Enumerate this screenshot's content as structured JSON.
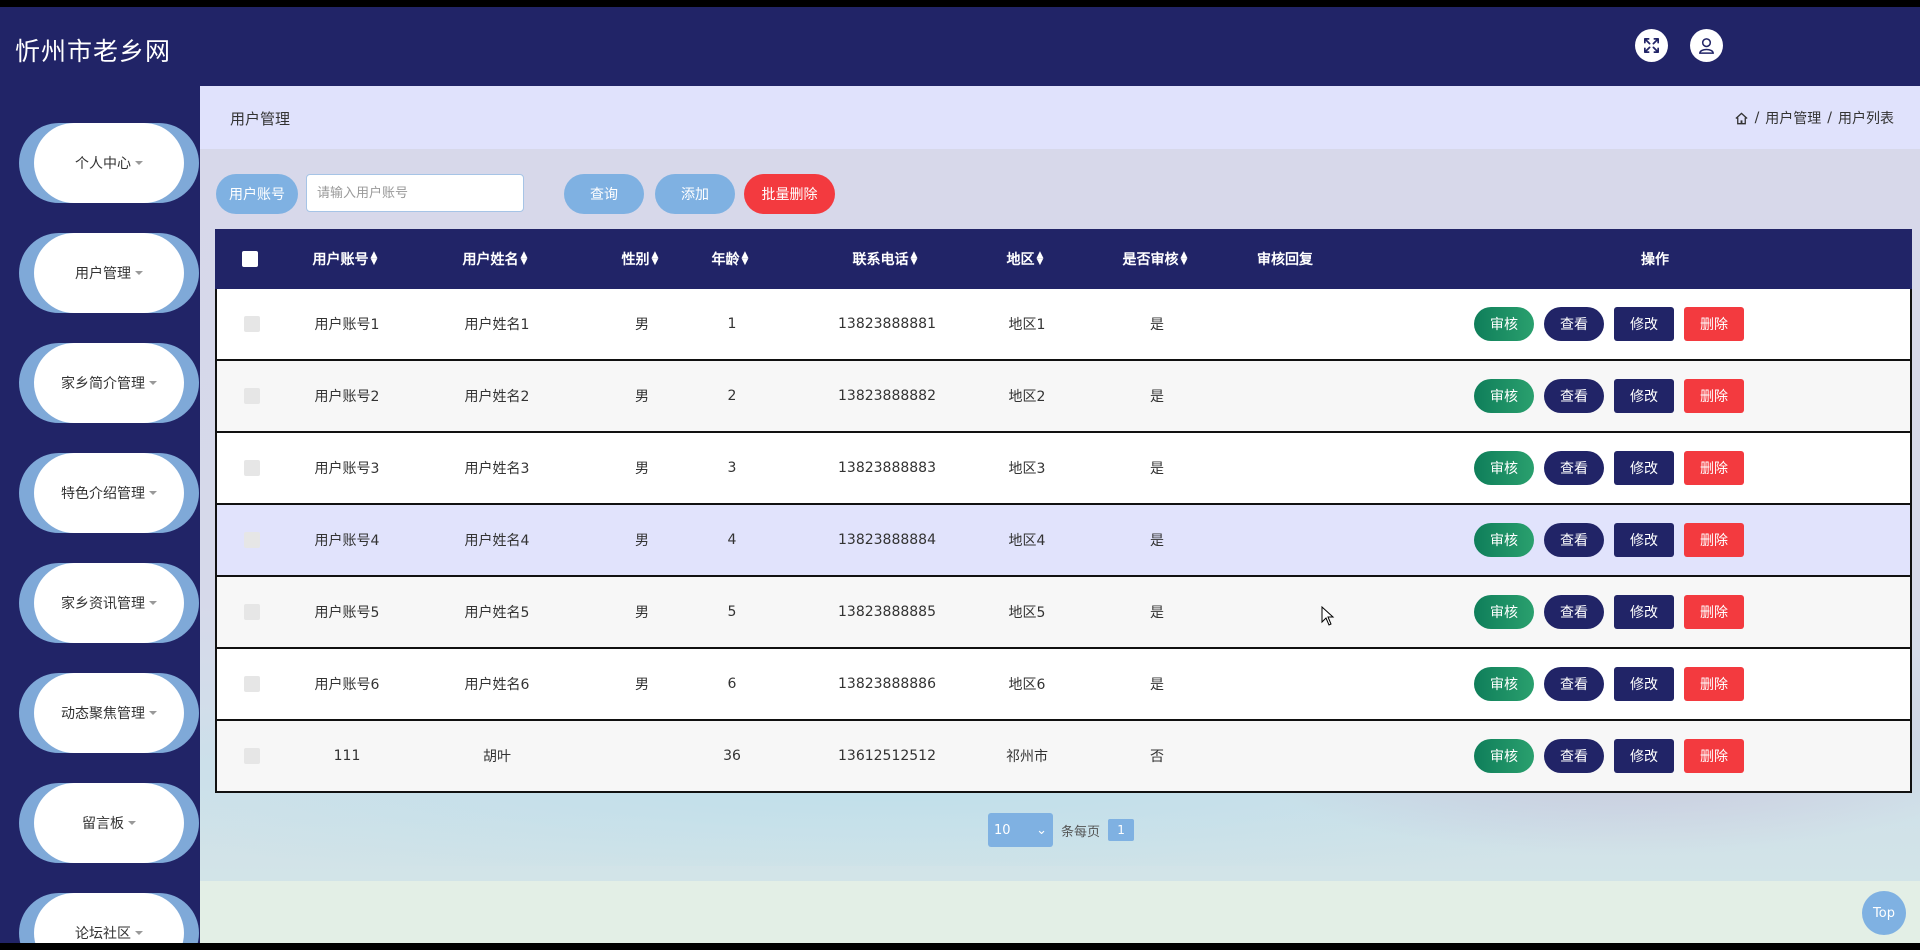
{
  "header": {
    "site_title": "忻州市老乡网"
  },
  "sidebar": {
    "items": [
      {
        "label": "个人中心"
      },
      {
        "label": "用户管理"
      },
      {
        "label": "家乡简介管理"
      },
      {
        "label": "特色介绍管理"
      },
      {
        "label": "家乡资讯管理"
      },
      {
        "label": "动态聚焦管理"
      },
      {
        "label": "留言板"
      },
      {
        "label": "论坛社区"
      }
    ]
  },
  "breadcrumb": {
    "page_title": "用户管理",
    "items": [
      "用户管理",
      "用户列表"
    ],
    "separator": "/"
  },
  "search": {
    "label": "用户账号",
    "placeholder": "请输入用户账号",
    "query_label": "查询",
    "add_label": "添加",
    "batch_delete_label": "批量删除"
  },
  "table": {
    "columns": {
      "account": "用户账号",
      "name": "用户姓名",
      "gender": "性别",
      "age": "年龄",
      "phone": "联系电话",
      "region": "地区",
      "reviewed": "是否审核",
      "reply": "审核回复",
      "ops": "操作"
    },
    "rows": [
      {
        "account": "用户账号1",
        "name": "用户姓名1",
        "gender": "男",
        "age": "1",
        "phone": "13823888881",
        "region": "地区1",
        "reviewed": "是",
        "reply": ""
      },
      {
        "account": "用户账号2",
        "name": "用户姓名2",
        "gender": "男",
        "age": "2",
        "phone": "13823888882",
        "region": "地区2",
        "reviewed": "是",
        "reply": ""
      },
      {
        "account": "用户账号3",
        "name": "用户姓名3",
        "gender": "男",
        "age": "3",
        "phone": "13823888883",
        "region": "地区3",
        "reviewed": "是",
        "reply": ""
      },
      {
        "account": "用户账号4",
        "name": "用户姓名4",
        "gender": "男",
        "age": "4",
        "phone": "13823888884",
        "region": "地区4",
        "reviewed": "是",
        "reply": ""
      },
      {
        "account": "用户账号5",
        "name": "用户姓名5",
        "gender": "男",
        "age": "5",
        "phone": "13823888885",
        "region": "地区5",
        "reviewed": "是",
        "reply": ""
      },
      {
        "account": "用户账号6",
        "name": "用户姓名6",
        "gender": "男",
        "age": "6",
        "phone": "13823888886",
        "region": "地区6",
        "reviewed": "是",
        "reply": ""
      },
      {
        "account": "111",
        "name": "胡叶",
        "gender": "",
        "age": "36",
        "phone": "13612512512",
        "region": "祁州市",
        "reviewed": "否",
        "reply": ""
      }
    ],
    "row_actions": {
      "review": "审核",
      "view": "查看",
      "edit": "修改",
      "delete": "删除"
    }
  },
  "pagination": {
    "page_size": "10",
    "per_page_label": "条每页",
    "current_page": "1"
  },
  "back_to_top": "Top",
  "icons": {
    "fullscreen": "fullscreen-icon",
    "user": "user-icon",
    "home": "home-icon"
  },
  "colors": {
    "primary_navy": "#212467",
    "accent_blue": "#7fb1e2",
    "review_green": "#0f8a5f",
    "delete_red": "#f33a3f",
    "breadcrumb_bg": "#e0e2fc"
  }
}
